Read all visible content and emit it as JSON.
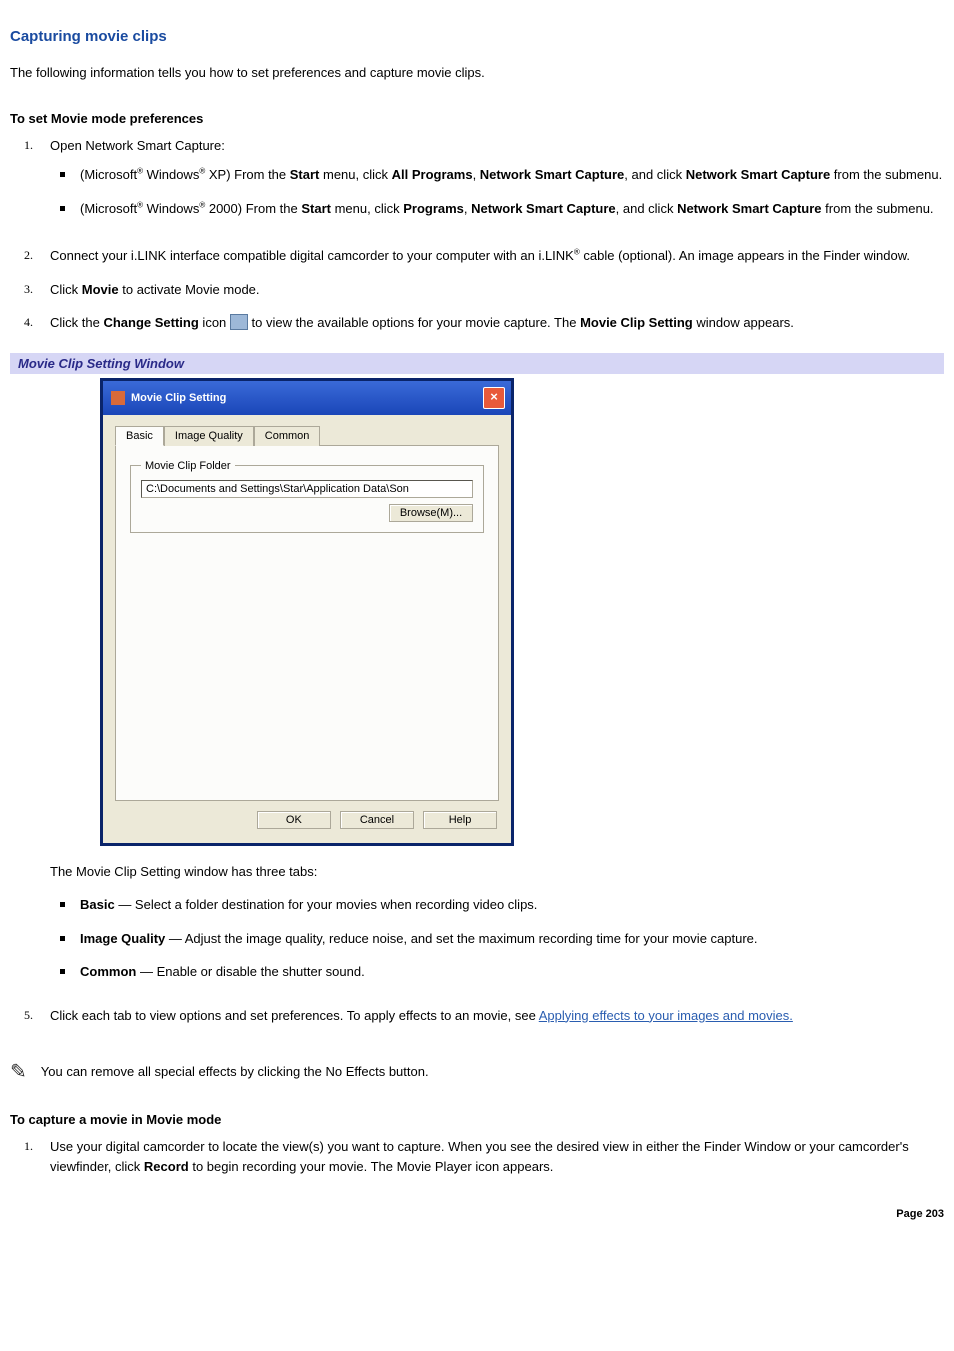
{
  "heading": "Capturing movie clips",
  "intro": "The following information tells you how to set preferences and capture movie clips.",
  "sub1": "To set Movie mode preferences",
  "step1_lead": "Open Network Smart Capture:",
  "xp": {
    "pre": "(Microsoft",
    "mid1": " Windows",
    "mid2": " XP) From the ",
    "b1": "Start",
    "t1": " menu, click ",
    "b2": "All Programs",
    "t2": ", ",
    "b3": "Network Smart Capture",
    "t3": ", and click ",
    "b4": "Network Smart Capture",
    "t4": " from the submenu."
  },
  "w2k": {
    "pre": "(Microsoft",
    "mid1": " Windows",
    "mid2": " 2000) From the ",
    "b1": "Start",
    "t1": " menu, click ",
    "b2": "Programs",
    "t2": ", ",
    "b3": "Network Smart Capture",
    "t3": ", and click ",
    "b4": "Network Smart Capture",
    "t4": " from the submenu."
  },
  "step2": {
    "pre": "Connect your i.LINK interface compatible digital camcorder to your computer with an i.LINK",
    "post": " cable (optional). An image appears in the Finder window."
  },
  "step3": {
    "pre": "Click ",
    "b": "Movie",
    "post": " to activate Movie mode."
  },
  "step4": {
    "pre": "Click the ",
    "b1": "Change Setting",
    "mid": " icon ",
    "post1": " to view the available options for your movie capture. The ",
    "b2": "Movie Clip Setting",
    "post2": " window appears."
  },
  "caption": "Movie Clip Setting Window",
  "dialog": {
    "title": "Movie Clip Setting",
    "tabs": [
      "Basic",
      "Image Quality",
      "Common"
    ],
    "group": "Movie Clip Folder",
    "path": "C:\\Documents and Settings\\Star\\Application Data\\Son",
    "browse": "Browse(M)...",
    "ok": "OK",
    "cancel": "Cancel",
    "help": "Help"
  },
  "tabs_intro": "The Movie Clip Setting window has three tabs:",
  "tabdesc": {
    "basic_b": "Basic",
    "basic_t": " — Select a folder destination for your movies when recording video clips.",
    "iq_b": "Image Quality",
    "iq_t": " — Adjust the image quality, reduce noise, and set the maximum recording time for your movie capture.",
    "common_b": "Common",
    "common_t": " — Enable or disable the shutter sound."
  },
  "step5": {
    "pre": "Click each tab to view options and set preferences. To apply effects to an movie, see ",
    "link": "Applying effects to your images and movies."
  },
  "note": "You can remove all special effects by clicking the No Effects button.",
  "sub2": "To capture a movie in Movie mode",
  "capture_step1": {
    "pre": "Use your digital camcorder to locate the view(s) you want to capture. When you see the desired view in either the Finder Window or your camcorder's viewfinder, click ",
    "b": "Record",
    "post": " to begin recording your movie. The Movie Player icon appears."
  },
  "pagenum": "Page 203",
  "reg": "®"
}
